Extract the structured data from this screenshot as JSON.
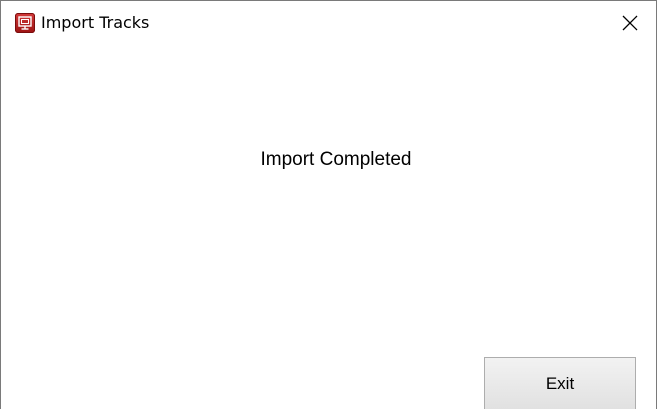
{
  "window": {
    "title": "Import Tracks",
    "app_icon": "red-app-icon",
    "close_icon": "close-icon"
  },
  "dialog": {
    "message": "Import Completed",
    "exit_label": "Exit"
  },
  "colors": {
    "app_icon_red": "#b51f1f",
    "button_bg": "#e1e1e1",
    "button_border": "#adadad",
    "window_border": "#7a7a7a"
  }
}
